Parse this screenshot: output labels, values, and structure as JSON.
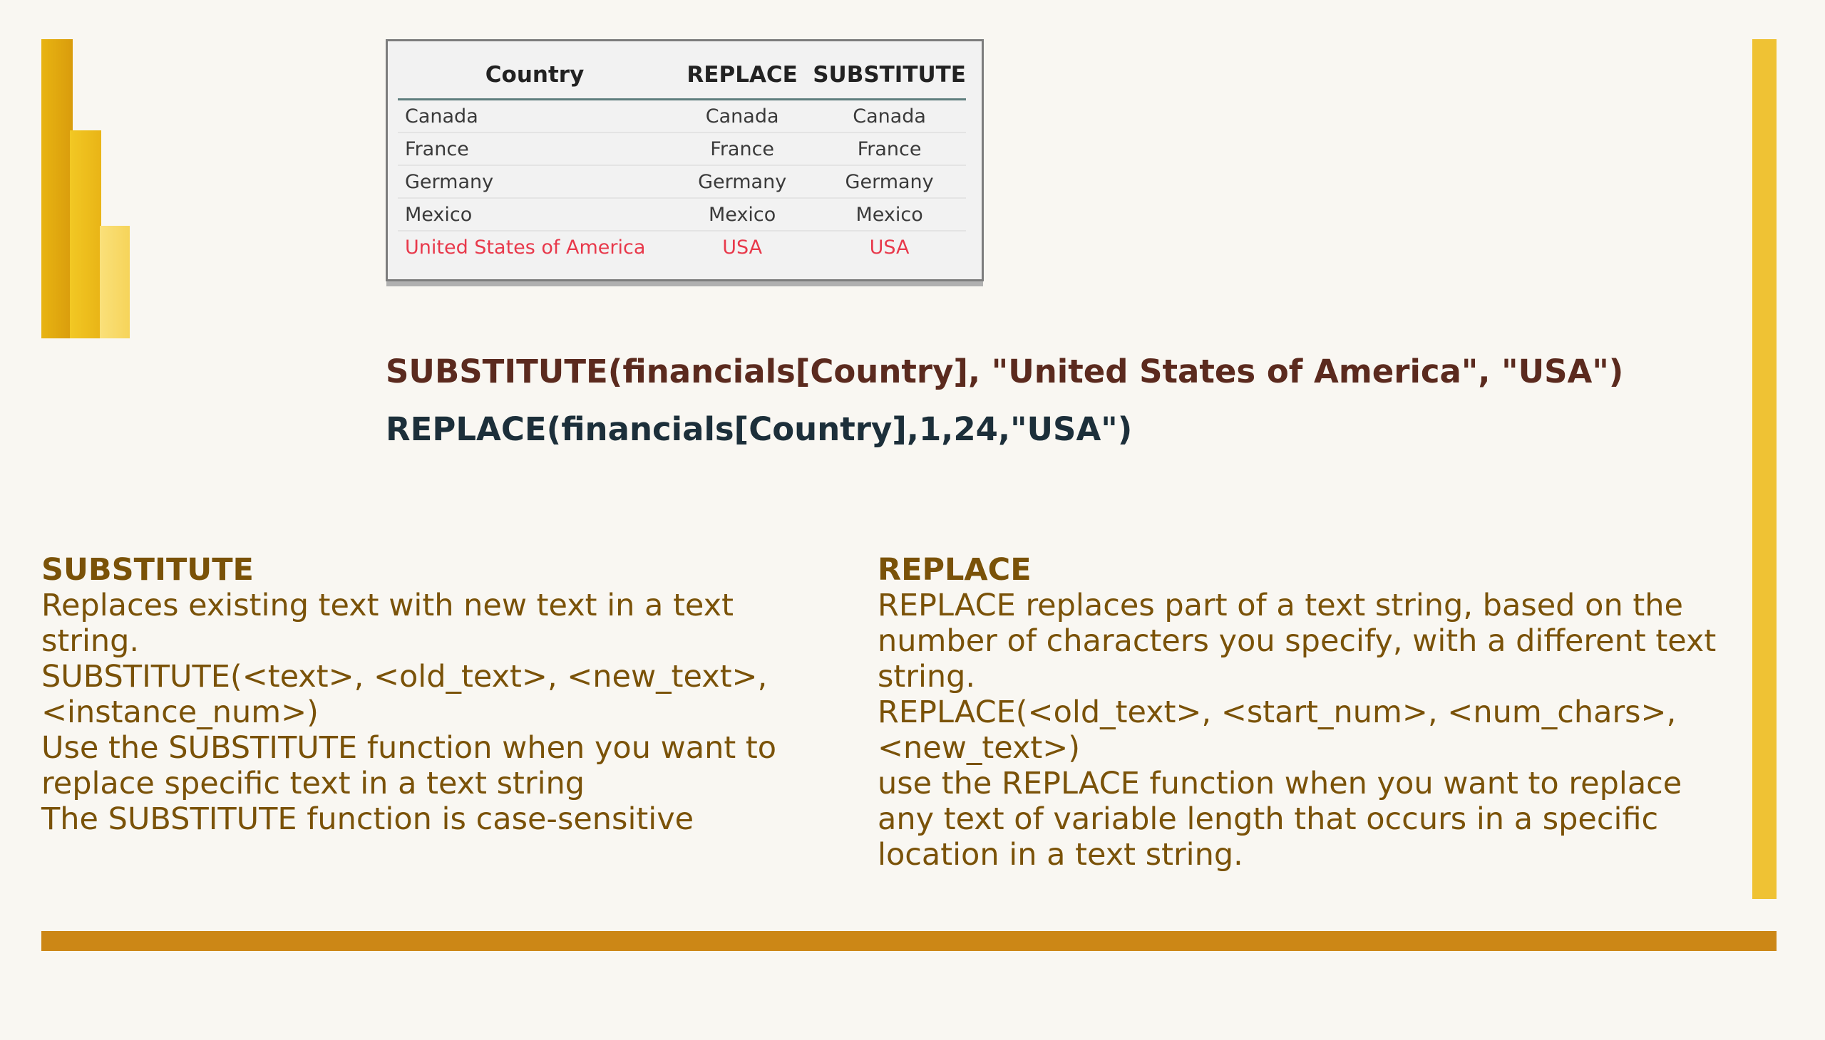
{
  "table": {
    "headers": [
      "Country",
      "REPLACE",
      "SUBSTITUTE"
    ],
    "rows": [
      [
        "Canada",
        "Canada",
        "Canada"
      ],
      [
        "France",
        "France",
        "France"
      ],
      [
        "Germany",
        "Germany",
        "Germany"
      ],
      [
        "Mexico",
        "Mexico",
        "Mexico"
      ],
      [
        "United States of America",
        "USA",
        "USA"
      ]
    ],
    "highlight_color": "#e8394b"
  },
  "formulas": {
    "substitute": "SUBSTITUTE(financials[Country], \"United States of America\", \"USA\")",
    "replace": "REPLACE(financials[Country],1,24,\"USA\")"
  },
  "substitute_section": {
    "title": "SUBSTITUTE",
    "lines": [
      "Replaces existing text with new text in a text string.",
      "SUBSTITUTE(<text>, <old_text>, <new_text>, <instance_num>)",
      "Use the SUBSTITUTE function when you want to replace specific text in a text string",
      "The SUBSTITUTE function is case-sensitive"
    ]
  },
  "replace_section": {
    "title": "REPLACE",
    "lines": [
      "REPLACE replaces part of a text string, based on the number of characters you specify, with a different text string.",
      "REPLACE(<old_text>, <start_num>, <num_chars>, <new_text>)",
      "use the REPLACE function when you want to replace any text of variable length that occurs in a specific location in a text string."
    ]
  },
  "colors": {
    "background": "#f9f7f2",
    "accent_gold": "#efc234",
    "bottom_bar": "#cc8716",
    "body_text": "#7a5208"
  }
}
